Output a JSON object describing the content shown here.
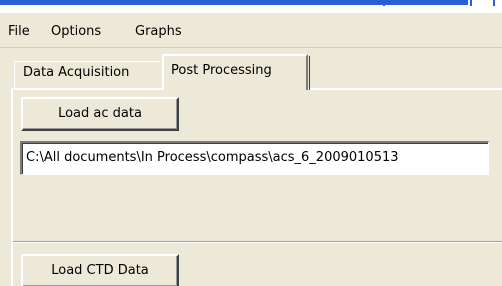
{
  "menu": {
    "items": [
      "File",
      "Options",
      "Graphs"
    ]
  },
  "tabs": [
    {
      "label": "Data Acquisition",
      "active": false
    },
    {
      "label": "Post Processing",
      "active": true
    }
  ],
  "post_processing": {
    "load_ac_button": "Load ac data",
    "file_path": "C:\\All documents\\In Process\\compass\\acs_6_2009010513",
    "load_ctd_button": "Load CTD Data"
  },
  "colors": {
    "window_background": "#ece9d8",
    "title_accent": "#2a5fd8"
  }
}
